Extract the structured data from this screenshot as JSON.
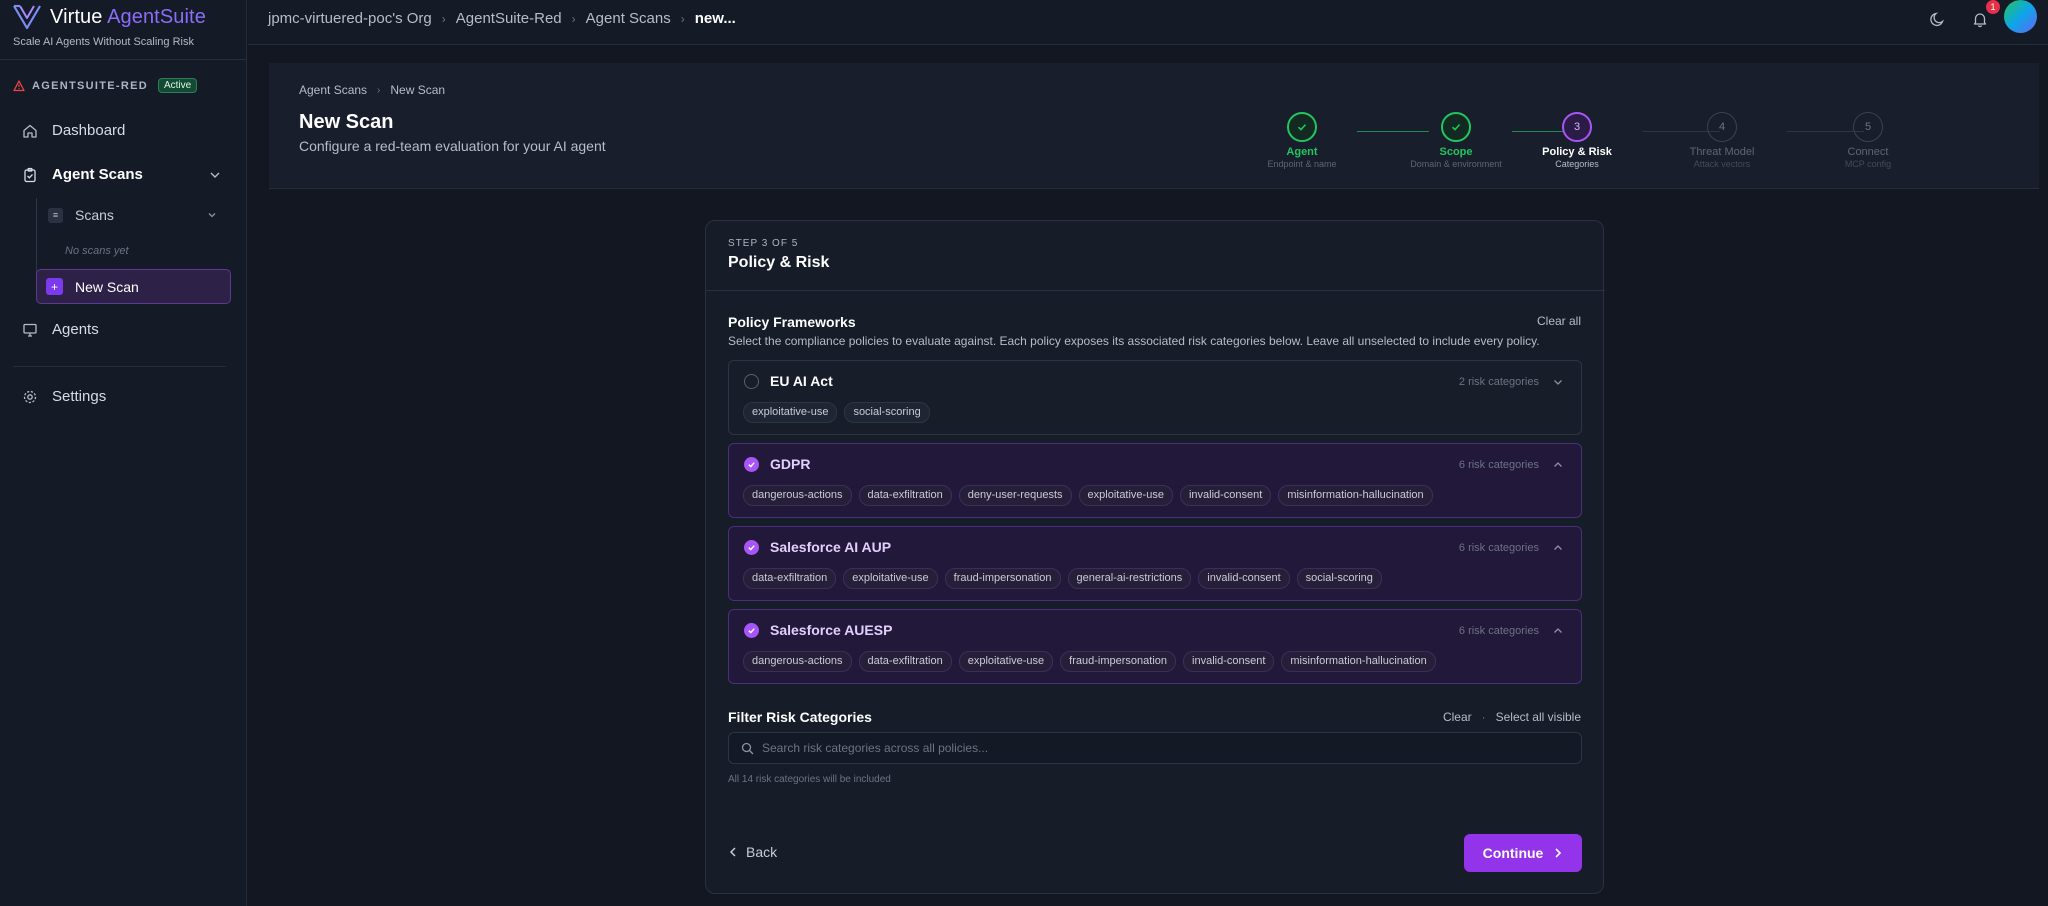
{
  "brand": {
    "name_main": "Virtue",
    "name_accent": "AgentSuite",
    "tagline": "Scale AI Agents Without Scaling Risk"
  },
  "environment": {
    "name": "AGENTSUITE-RED",
    "status": "Active"
  },
  "sidebar": {
    "dashboard": "Dashboard",
    "agent_scans": "Agent Scans",
    "scans": "Scans",
    "no_scans": "No scans yet",
    "new_scan": "New Scan",
    "agents": "Agents",
    "settings": "Settings"
  },
  "topbar": {
    "breadcrumbs": [
      "jpmc-virtuered-poc's Org",
      "AgentSuite-Red",
      "Agent Scans",
      "new..."
    ],
    "notifications": "1"
  },
  "header": {
    "breadcrumbs": [
      "Agent Scans",
      "New Scan"
    ],
    "title": "New Scan",
    "subtitle": "Configure a red-team evaluation for your AI agent",
    "steps": [
      {
        "num": "1",
        "label": "Agent",
        "sub": "Endpoint & name",
        "state": "done"
      },
      {
        "num": "2",
        "label": "Scope",
        "sub": "Domain & environment",
        "state": "done"
      },
      {
        "num": "3",
        "label": "Policy & Risk",
        "sub": "Categories",
        "state": "active"
      },
      {
        "num": "4",
        "label": "Threat Model",
        "sub": "Attack vectors",
        "state": "todo"
      },
      {
        "num": "5",
        "label": "Connect",
        "sub": "MCP config",
        "state": "todo"
      }
    ]
  },
  "card": {
    "step_of": "STEP 3 OF 5",
    "title": "Policy & Risk",
    "frameworks_title": "Policy Frameworks",
    "frameworks_desc": "Select the compliance policies to evaluate against. Each policy exposes its associated risk categories below. Leave all unselected to include every policy.",
    "clear_all": "Clear all",
    "policies": [
      {
        "name": "EU AI Act",
        "count": "2 risk categories",
        "selected": false,
        "tags": [
          "exploitative-use",
          "social-scoring"
        ]
      },
      {
        "name": "GDPR",
        "count": "6 risk categories",
        "selected": true,
        "tags": [
          "dangerous-actions",
          "data-exfiltration",
          "deny-user-requests",
          "exploitative-use",
          "invalid-consent",
          "misinformation-hallucination"
        ]
      },
      {
        "name": "Salesforce AI AUP",
        "count": "6 risk categories",
        "selected": true,
        "tags": [
          "data-exfiltration",
          "exploitative-use",
          "fraud-impersonation",
          "general-ai-restrictions",
          "invalid-consent",
          "social-scoring"
        ]
      },
      {
        "name": "Salesforce AUESP",
        "count": "6 risk categories",
        "selected": true,
        "tags": [
          "dangerous-actions",
          "data-exfiltration",
          "exploitative-use",
          "fraud-impersonation",
          "invalid-consent",
          "misinformation-hallucination"
        ]
      }
    ],
    "filter_title": "Filter Risk Categories",
    "filter_clear": "Clear",
    "filter_select_all": "Select all visible",
    "search_placeholder": "Search risk categories across all policies...",
    "search_value": "",
    "hint": "All 14 risk categories will be included",
    "back": "Back",
    "continue": "Continue"
  },
  "colors": {
    "accent": "#9333ea",
    "success": "#22c55e",
    "background": "#121722"
  }
}
